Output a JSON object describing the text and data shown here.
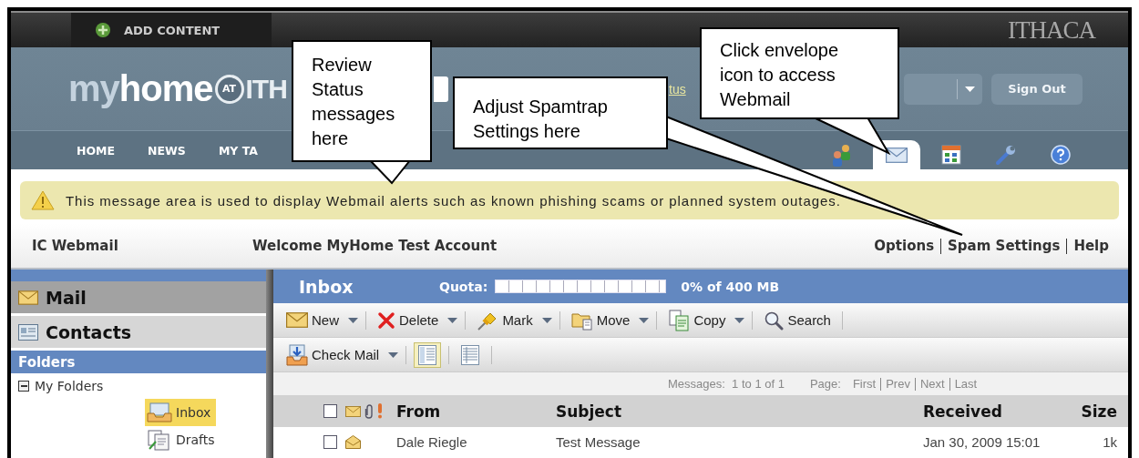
{
  "top_bar": {
    "add_content": "ADD CONTENT",
    "brand": "ITHACA"
  },
  "header": {
    "logo": {
      "part_1": "my",
      "part_2": "home",
      "badge": "AT",
      "part_3": "ITH"
    },
    "status_link": "tus",
    "sign_out": "Sign Out"
  },
  "nav": {
    "tabs": [
      {
        "label": "HOME"
      },
      {
        "label": "NEWS"
      },
      {
        "label": "MY TA"
      }
    ],
    "icon_tabs": [
      {
        "kind": "people",
        "selected": false
      },
      {
        "kind": "mail",
        "selected": true
      },
      {
        "kind": "calendar",
        "selected": false
      },
      {
        "kind": "settings",
        "selected": false
      },
      {
        "kind": "help",
        "selected": false
      }
    ]
  },
  "alert": "This message area is used to display Webmail alerts such as known phishing scams or planned system outages.",
  "app_bar": {
    "title": "IC Webmail",
    "welcome": "Welcome MyHome Test Account",
    "links": [
      "Options",
      "Spam Settings",
      "Help"
    ]
  },
  "sidebar": {
    "sections": [
      {
        "kind": "mail",
        "label": "Mail",
        "selected": true
      },
      {
        "kind": "contacts",
        "label": "Contacts",
        "selected": false
      }
    ],
    "folders_title": "Folders",
    "tree": [
      {
        "label": "My Folders",
        "expanded": true,
        "children": [
          {
            "kind": "inbox",
            "label": "Inbox",
            "selected": true
          },
          {
            "kind": "drafts",
            "label": "Drafts",
            "selected": false
          }
        ]
      }
    ]
  },
  "mailbox": {
    "title": "Inbox",
    "quota_label": "Quota:",
    "quota": {
      "level": 0
    },
    "quota_text": "0% of 400 MB",
    "toolbar": [
      {
        "kind": "new",
        "label": "New",
        "dropdown": true
      },
      {
        "kind": "delete",
        "label": "Delete",
        "dropdown": true
      },
      {
        "kind": "mark",
        "label": "Mark",
        "dropdown": true
      },
      {
        "kind": "move",
        "label": "Move",
        "dropdown": true
      },
      {
        "kind": "copy",
        "label": "Copy",
        "dropdown": true
      },
      {
        "kind": "search",
        "label": "Search",
        "dropdown": false
      }
    ],
    "toolbar_2": [
      {
        "kind": "checkmail",
        "label": "Check Mail",
        "dropdown": true
      }
    ],
    "view_buttons": [
      {
        "kind": "preview",
        "selected": true
      },
      {
        "kind": "list",
        "selected": false
      }
    ],
    "messages_count": "Messages:  1 to 1 of 1",
    "page_label": "Page:",
    "pager": [
      "First",
      "Prev",
      "Next",
      "Last"
    ],
    "table": {
      "select_all": {
        "checked": false
      },
      "columns": [
        "From",
        "Subject",
        "Received",
        "Size"
      ],
      "rows": [
        {
          "checked": false,
          "unread": false,
          "from": "Dale Riegle",
          "subject": "Test Message",
          "received": "Jan 30, 2009 15:01",
          "size": "1k"
        }
      ]
    }
  },
  "callouts": [
    {
      "text": "Review Status messages here"
    },
    {
      "text": "Adjust Spamtrap Settings here"
    },
    {
      "text": "Click envelope icon to access Webmail"
    }
  ]
}
